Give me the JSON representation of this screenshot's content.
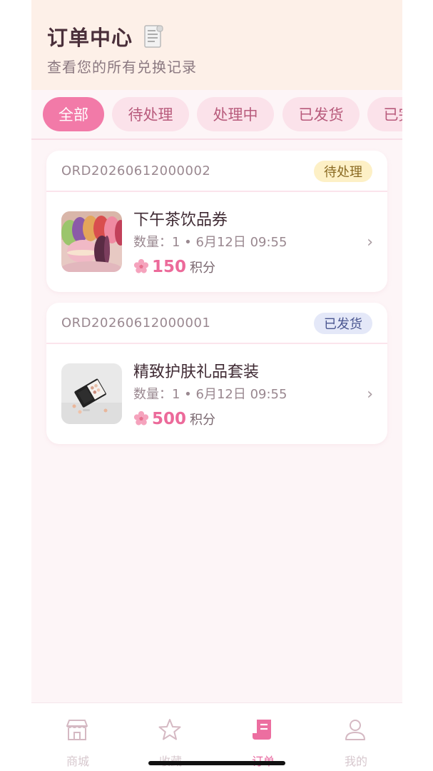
{
  "header": {
    "title": "订单中心",
    "subtitle": "查看您的所有兑换记录"
  },
  "tabs": [
    {
      "label": "全部",
      "active": true
    },
    {
      "label": "待处理",
      "active": false
    },
    {
      "label": "处理中",
      "active": false
    },
    {
      "label": "已发货",
      "active": false
    },
    {
      "label": "已完成",
      "active": false
    }
  ],
  "orders": [
    {
      "order_no": "ORD20260612000002",
      "status": "待处理",
      "item_name": "下午茶饮品券",
      "meta": "数量：1 • 6月12日 09:55",
      "points": "150",
      "unit": "积分"
    },
    {
      "order_no": "ORD20260612000001",
      "status": "已发货",
      "item_name": "精致护肤礼品套装",
      "meta": "数量：1 • 6月12日 09:55",
      "points": "500",
      "unit": "积分"
    }
  ],
  "nav": [
    {
      "label": "商城",
      "icon": "store-icon"
    },
    {
      "label": "收藏",
      "icon": "star-icon"
    },
    {
      "label": "订单",
      "icon": "receipt-icon"
    },
    {
      "label": "我的",
      "icon": "user-icon"
    }
  ],
  "colors": {
    "accent": "#f27aa8",
    "header_bg": "#fdf0e8",
    "pending_badge": "#fdf0c6",
    "shipped_badge": "#e4e8f8"
  }
}
